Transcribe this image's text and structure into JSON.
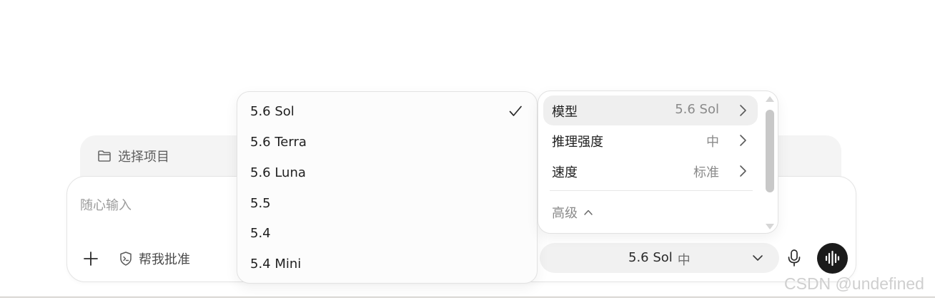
{
  "project_bar": {
    "label": "选择项目",
    "icon": "folder-icon"
  },
  "composer": {
    "placeholder": "随心输入",
    "approve_label": "帮我批准",
    "approve_icon": "shield-terminal-icon",
    "model_pill": {
      "model": "5.6 Sol",
      "level": "中"
    }
  },
  "model_list": {
    "items": [
      {
        "label": "5.6 Sol",
        "selected": true
      },
      {
        "label": "5.6 Terra",
        "selected": false
      },
      {
        "label": "5.6 Luna",
        "selected": false
      },
      {
        "label": "5.5",
        "selected": false
      },
      {
        "label": "5.4",
        "selected": false
      },
      {
        "label": "5.4 Mini",
        "selected": false
      }
    ]
  },
  "settings_menu": {
    "rows": [
      {
        "label": "模型",
        "value": "5.6 Sol",
        "active": true
      },
      {
        "label": "推理强度",
        "value": "中",
        "active": false
      },
      {
        "label": "速度",
        "value": "标准",
        "active": false
      }
    ],
    "advanced_label": "高级"
  },
  "watermark": "CSDN @undefined",
  "colors": {
    "voice_button": "#1b1b1b",
    "active_row": "#efefef",
    "pill_bg": "#f1f1f1"
  }
}
